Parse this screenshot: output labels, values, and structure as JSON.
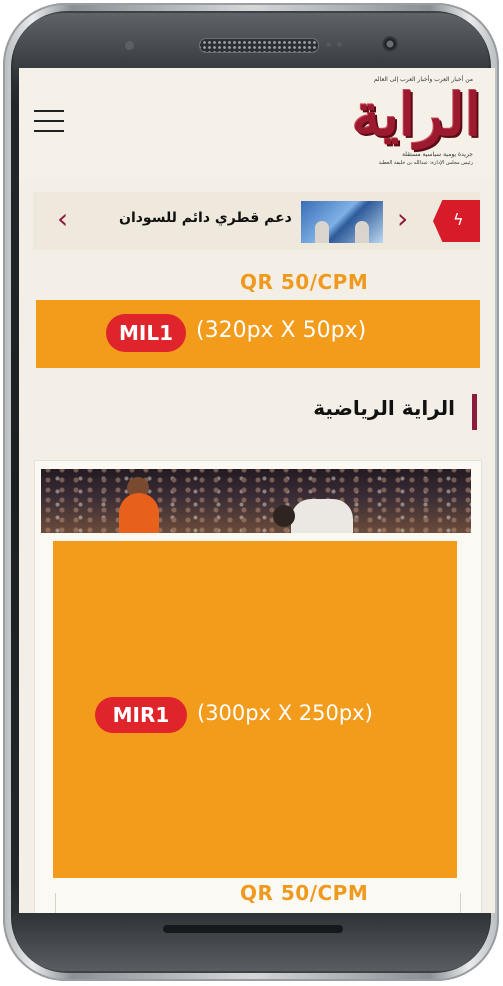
{
  "header": {
    "logo_text": "الراية",
    "logo_tagline": "من أخبار العرب وأخبار العرب إلى العالم",
    "logo_subtitle": "جريدة يومية سياسية مستقلة",
    "logo_owner": "رئيس مجلس الإدارة: عبدالله بن خليفة العطية"
  },
  "ticker": {
    "headline": "دعم قطري دائم للسودان",
    "prev_glyph": "‹",
    "next_glyph": "›",
    "breaking_glyph": "ϟ"
  },
  "ads": {
    "price_top": "QR 50/CPM",
    "leader_code": "MIL1",
    "leader_dims": "(320px X 50px)",
    "rect_code": "MIR1",
    "rect_dims": "(300px X 250px)",
    "price_bottom": "QR 50/CPM"
  },
  "section": {
    "title": "الراية الرياضية"
  },
  "colors": {
    "brand": "#9b1a2e",
    "ad_orange": "#f39c1c",
    "ad_pill_red": "#e0242b",
    "section_bar": "#8c1c3d",
    "background": "#f3efe6"
  },
  "icons": [
    "menu-icon",
    "chevron-left-icon",
    "chevron-right-icon",
    "lightning-icon"
  ]
}
